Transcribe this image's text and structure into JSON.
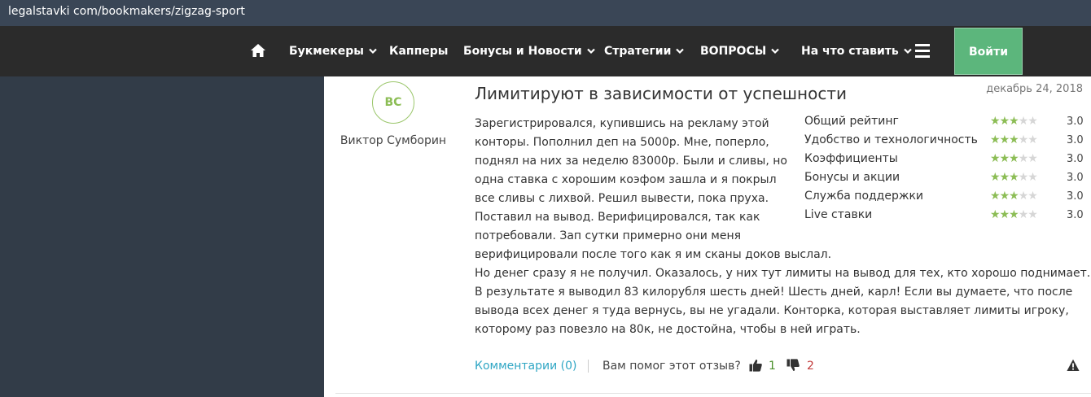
{
  "browser": {
    "url": "legalstavki com/bookmakers/zigzag-sport"
  },
  "nav": {
    "home_icon": "home-icon",
    "items": [
      {
        "label": "Букмекеры",
        "has_dropdown": true
      },
      {
        "label": "Капперы",
        "has_dropdown": false
      },
      {
        "label": "Бонусы и Новости",
        "has_dropdown": true
      },
      {
        "label": "Стратегии",
        "has_dropdown": true
      },
      {
        "label": "ВОПРОСЫ",
        "has_dropdown": true
      },
      {
        "label": "На что ставить",
        "has_dropdown": true
      }
    ],
    "menu_icon": "hamburger-icon",
    "login_label": "Войти",
    "login_color": "#5cb67c"
  },
  "review": {
    "avatar_initials": "ВС",
    "author": "Виктор Сумборин",
    "title": "Лимитируют в зависимости от успешности",
    "date": "декабрь 24, 2018",
    "body_lines": [
      "Зарегистрировался, купившись на рекламу этой",
      "конторы. Пополнил деп на 5000р. Мне, поперло,",
      "поднял на них за неделю 83000р. Были и сливы, но",
      "одна ставка с хорошим коэфом зашла и я покрыл",
      "все сливы с лихвой. Решил вывести, пока пруха.",
      "Поставил на вывод. Верифицировался, так как",
      "потребовали. Зап сутки примерно они меня",
      "верифицировали после того как я им сканы доков выслал.",
      "Но денег сразу я не получил. Оказалось, у них тут лимиты на вывод для тех, кто хорошо поднимает.",
      "В результате я выводил 83 килорубля шесть дней! Шесть дней, карл! Если вы думаете, что после",
      "вывода всех денег я туда вернусь, вы не угадали. Конторка, которая выставляет лимиты игроку,",
      "которому раз повезло на 80к, не достойна, чтобы в ней играть."
    ],
    "ratings": [
      {
        "label": "Общий рейтинг",
        "stars": 3,
        "max": 5,
        "value": "3.0"
      },
      {
        "label": "Удобство и технологичность",
        "stars": 3,
        "max": 5,
        "value": "3.0"
      },
      {
        "label": "Коэффициенты",
        "stars": 3,
        "max": 5,
        "value": "3.0"
      },
      {
        "label": "Бонусы и акции",
        "stars": 3,
        "max": 5,
        "value": "3.0"
      },
      {
        "label": "Служба поддержки",
        "stars": 3,
        "max": 5,
        "value": "3.0"
      },
      {
        "label": "Live ставки",
        "stars": 3,
        "max": 5,
        "value": "3.0"
      }
    ],
    "star_color": "#8cbd55",
    "footer": {
      "comments_label": "Комментарии (0)",
      "helpful_question": "Вам помог этот отзыв?",
      "thumbs_up_count": "1",
      "thumbs_down_count": "2",
      "report_icon": "warning-icon"
    }
  }
}
